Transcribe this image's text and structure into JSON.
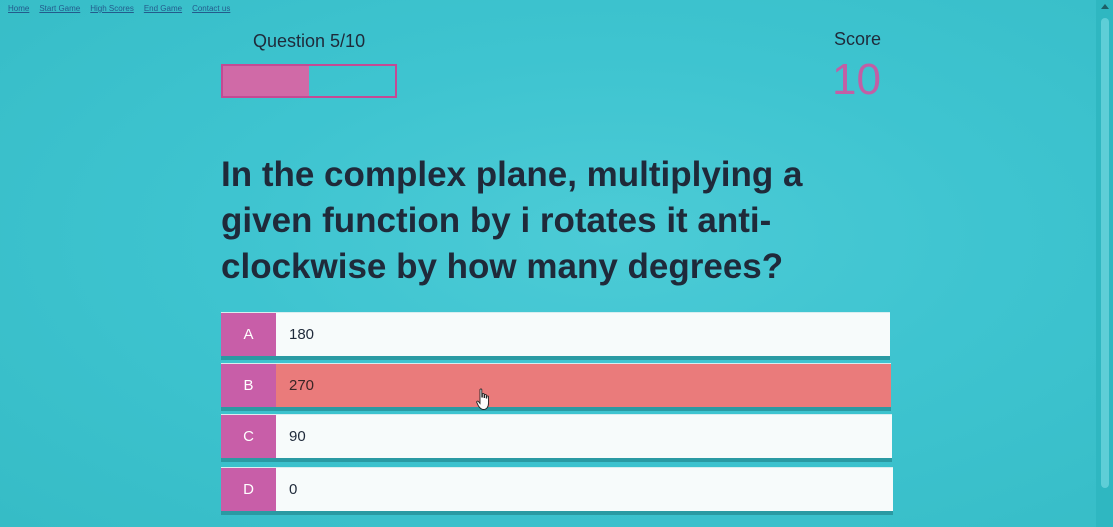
{
  "nav": {
    "items": [
      {
        "label": "Home"
      },
      {
        "label": "Start Game"
      },
      {
        "label": "High Scores"
      },
      {
        "label": "End Game"
      },
      {
        "label": "Contact us"
      }
    ]
  },
  "hud": {
    "question_count": "Question 5/10",
    "progress_fraction": 0.5,
    "score_label": "Score",
    "score_value": "10"
  },
  "question": {
    "text": "In the complex plane, multiplying a given function by i rotates it anti-clockwise by how many degrees?"
  },
  "answers": [
    {
      "prefix": "A",
      "text": "180",
      "selected": false
    },
    {
      "prefix": "B",
      "text": "270",
      "selected": true
    },
    {
      "prefix": "C",
      "text": "90",
      "selected": false
    },
    {
      "prefix": "D",
      "text": "0",
      "selected": false
    }
  ],
  "colors": {
    "background": "#3ec4d0",
    "accent": "#c85ea8",
    "selected_answer": "#ea7b7b",
    "answer_background": "#f7fbfb"
  }
}
